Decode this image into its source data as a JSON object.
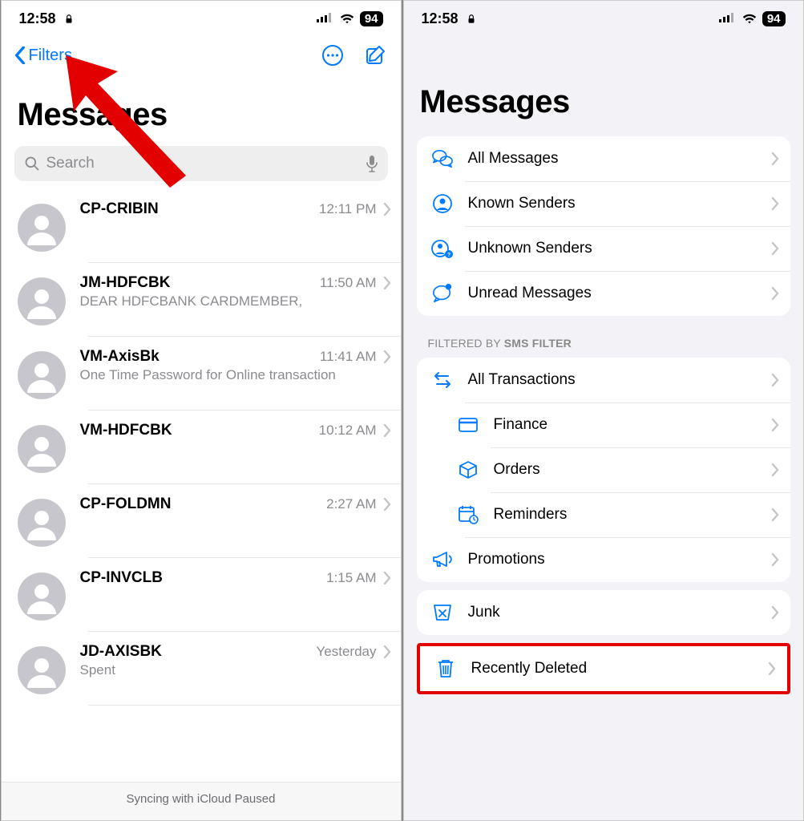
{
  "status": {
    "time": "12:58",
    "battery": "94"
  },
  "leftPhone": {
    "nav": {
      "back": "Filters"
    },
    "title": "Messages",
    "search": {
      "placeholder": "Search"
    },
    "conversations": [
      {
        "name": "CP-CRIBIN",
        "time": "12:11 PM",
        "preview": ""
      },
      {
        "name": "JM-HDFCBK",
        "time": "11:50 AM",
        "preview": "DEAR HDFCBANK CARDMEMBER,"
      },
      {
        "name": "VM-AxisBk",
        "time": "11:41 AM",
        "preview": "One Time Password for Online transaction"
      },
      {
        "name": "VM-HDFCBK",
        "time": "10:12 AM",
        "preview": ""
      },
      {
        "name": "CP-FOLDMN",
        "time": "2:27 AM",
        "preview": ""
      },
      {
        "name": "CP-INVCLB",
        "time": "1:15 AM",
        "preview": ""
      },
      {
        "name": "JD-AXISBK",
        "time": "Yesterday",
        "preview": "Spent"
      }
    ],
    "footer": "Syncing with iCloud Paused"
  },
  "rightPhone": {
    "title": "Messages",
    "sectionLabel": {
      "prefix": "FILTERED BY ",
      "strong": "SMS FILTER"
    },
    "mainFilters": [
      {
        "label": "All Messages",
        "icon": "chat-bubbles"
      },
      {
        "label": "Known Senders",
        "icon": "person-circle"
      },
      {
        "label": "Unknown Senders",
        "icon": "person-question"
      },
      {
        "label": "Unread Messages",
        "icon": "chat-dot"
      }
    ],
    "smsFilters": {
      "top": {
        "label": "All Transactions",
        "icon": "arrows-swap"
      },
      "sub": [
        {
          "label": "Finance",
          "icon": "card"
        },
        {
          "label": "Orders",
          "icon": "box"
        },
        {
          "label": "Reminders",
          "icon": "calendar-clock"
        }
      ],
      "bottom": {
        "label": "Promotions",
        "icon": "megaphone"
      }
    },
    "junk": {
      "label": "Junk",
      "icon": "junk-bin"
    },
    "deleted": {
      "label": "Recently Deleted",
      "icon": "trash"
    }
  }
}
